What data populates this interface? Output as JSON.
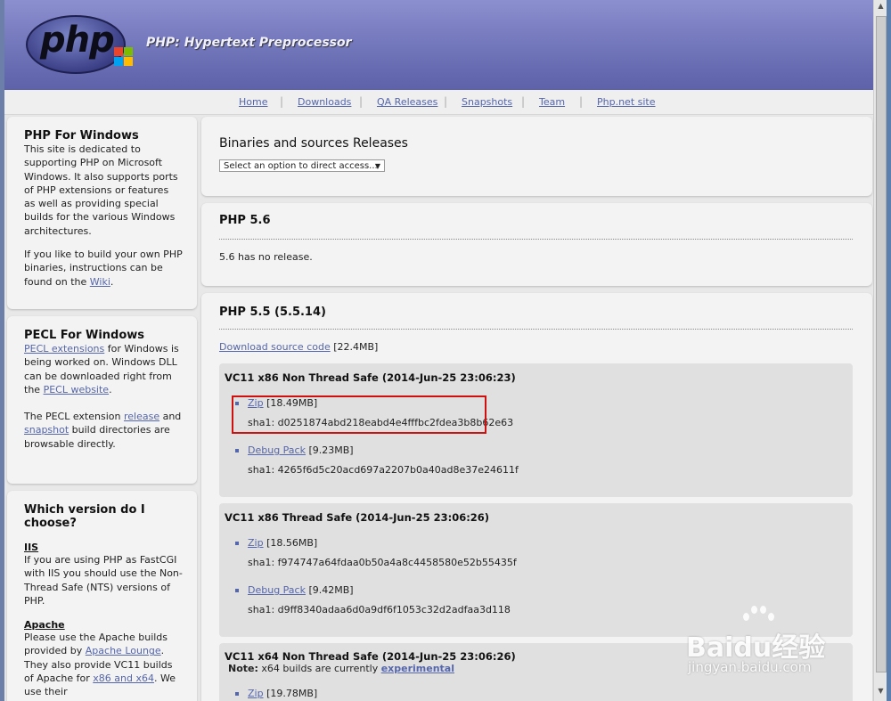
{
  "site": {
    "title": "PHP: Hypertext Preprocessor",
    "logo_text": "php"
  },
  "nav": [
    "Home",
    "Downloads",
    "QA Releases",
    "Snapshots",
    "Team",
    "Php.net site"
  ],
  "sidebar": {
    "windows": {
      "title": "PHP For Windows",
      "p1": "This site is dedicated to supporting PHP on Microsoft Windows. It also supports ports of PHP extensions or features as well as providing special builds for the various Windows architectures.",
      "p2_pre": "If you like to build your own PHP binaries, instructions can be found on the ",
      "p2_link": "Wiki",
      "p2_post": "."
    },
    "pecl": {
      "title": "PECL For Windows",
      "link1": "PECL extensions",
      "t1": " for Windows is being worked on. Windows DLL can be downloaded right from the ",
      "link2": "PECL website",
      "t2": ".",
      "t3": "The PECL extension ",
      "link3": "release",
      "t4": " and ",
      "link4": "snapshot",
      "t5": " build directories are browsable directly."
    },
    "which": {
      "title": "Which version do I choose?",
      "iis_h": "IIS",
      "iis_p": "If you are using PHP as FastCGI with IIS you should use the Non-Thread Safe (NTS) versions of PHP.",
      "apache_h": "Apache",
      "apache_p1": "Please use the Apache builds provided by ",
      "apache_link": "Apache Lounge",
      "apache_p2": ". They also provide VC11 builds of Apache for ",
      "apache_link2": "x86 and x64",
      "apache_p3": ". We use their"
    }
  },
  "main": {
    "releases_title": "Binaries and sources Releases",
    "select_placeholder": "Select an option to direct access...",
    "php56": {
      "title": "PHP 5.6",
      "note": "5.6 has no release."
    },
    "php55": {
      "title": "PHP 5.5 (5.5.14)",
      "source_link": "Download source code",
      "source_size": "[22.4MB]",
      "builds": [
        {
          "title": "VC11 x86 Non Thread Safe (2014-Jun-25 23:06:23)",
          "zip": "Zip",
          "zip_size": "[18.49MB]",
          "zip_sha": "sha1: d0251874abd218eabd4e4fffbc2fdea3b8b62e63",
          "debug": "Debug Pack",
          "debug_size": "[9.23MB]",
          "debug_sha": "sha1: 4265f6d5c20acd697a2207b0a40ad8e37e24611f"
        },
        {
          "title": "VC11 x86 Thread Safe (2014-Jun-25 23:06:26)",
          "zip": "Zip",
          "zip_size": "[18.56MB]",
          "zip_sha": "sha1: f974747a64fdaa0b50a4a8c4458580e52b55435f",
          "debug": "Debug Pack",
          "debug_size": "[9.42MB]",
          "debug_sha": "sha1: d9ff8340adaa6d0a9df6f1053c32d2adfaa3d118"
        },
        {
          "title": "VC11 x64 Non Thread Safe (2014-Jun-25 23:06:26)",
          "note_label": "Note:",
          "note_text": " x64 builds are currently ",
          "note_link": "experimental",
          "zip": "Zip",
          "zip_size": "[19.78MB]"
        }
      ]
    }
  },
  "watermark": {
    "brand": "Baidu经验",
    "url": "jingyan.baidu.com"
  },
  "colors": {
    "header": "#6e72b7",
    "link": "#5566aa",
    "highlight": "#cc1111"
  }
}
